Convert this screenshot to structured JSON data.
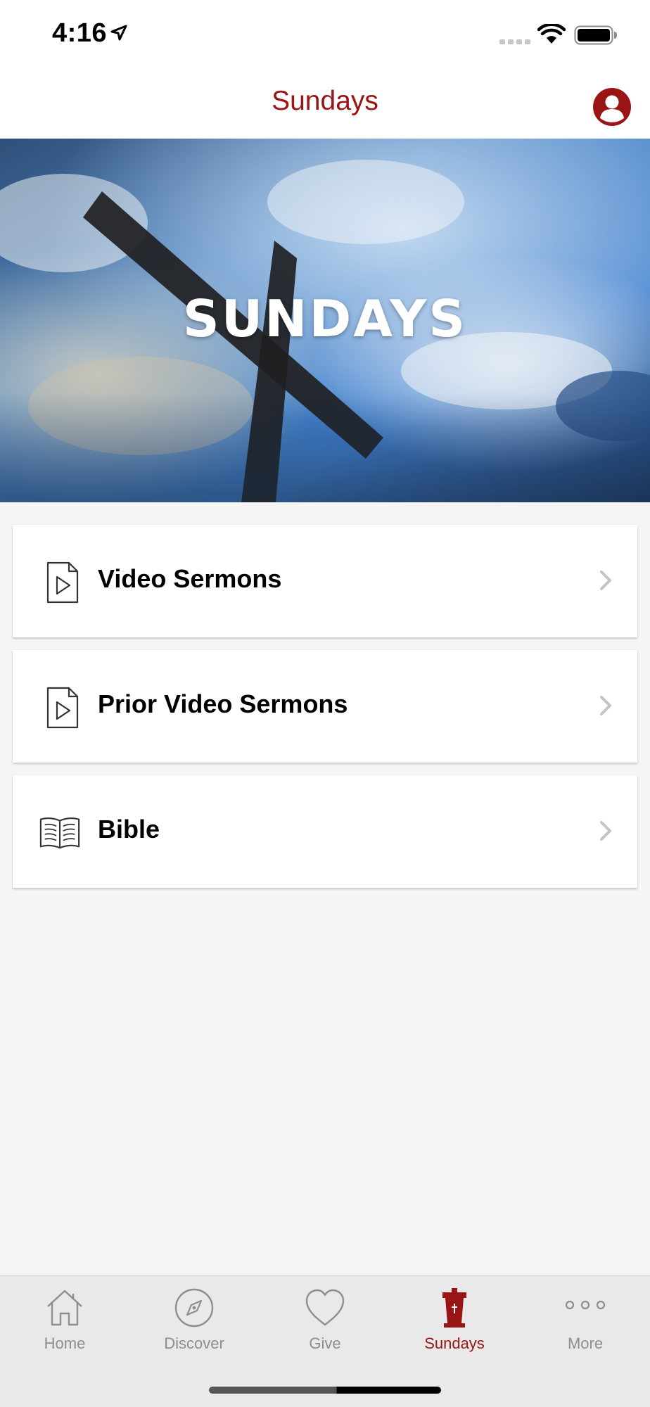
{
  "status_bar": {
    "time": "4:16"
  },
  "nav": {
    "title": "Sundays",
    "profile_icon": "profile-icon"
  },
  "hero": {
    "title": "SUNDAYS"
  },
  "list": {
    "items": [
      {
        "label": "Video Sermons",
        "icon": "video-file-icon"
      },
      {
        "label": "Prior Video Sermons",
        "icon": "video-file-icon"
      },
      {
        "label": "Bible",
        "icon": "open-book-icon"
      }
    ]
  },
  "tab_bar": {
    "tabs": [
      {
        "label": "Home",
        "icon": "home-icon",
        "active": false
      },
      {
        "label": "Discover",
        "icon": "compass-icon",
        "active": false
      },
      {
        "label": "Give",
        "icon": "heart-icon",
        "active": false
      },
      {
        "label": "Sundays",
        "icon": "pulpit-icon",
        "active": true
      },
      {
        "label": "More",
        "icon": "more-dots-icon",
        "active": false
      }
    ]
  },
  "colors": {
    "accent": "#9b1414",
    "inactive": "#8e8e8e",
    "background": "#f5f5f5"
  }
}
